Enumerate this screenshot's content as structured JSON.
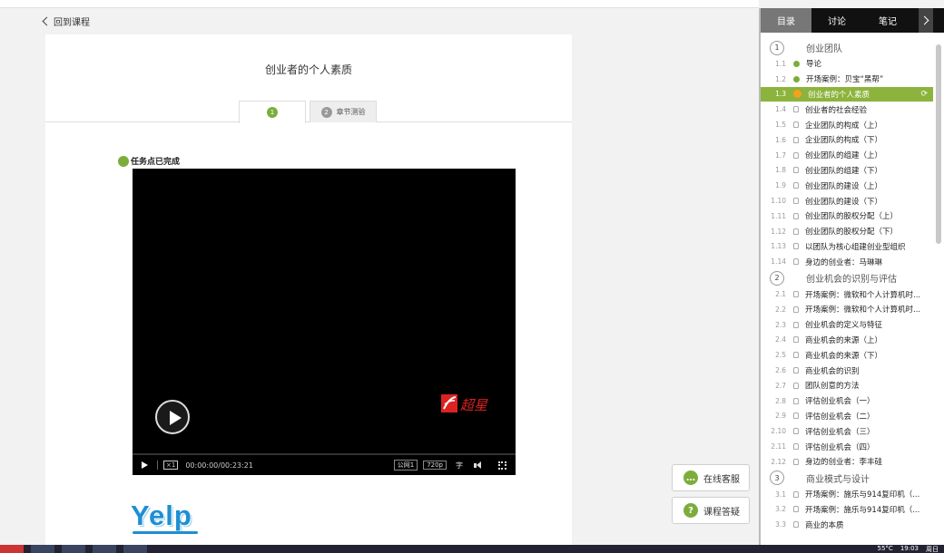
{
  "nav": {
    "back_label": "回到课程"
  },
  "lesson": {
    "title": "创业者的个人素质",
    "tabs": [
      {
        "num": "1",
        "label": ""
      },
      {
        "num": "2",
        "label": "章节测验"
      }
    ],
    "task_status": "任务点已完成"
  },
  "video": {
    "speed": "×1",
    "time": "00:00:00/00:23:21",
    "line_label": "公网1",
    "quality": "720p",
    "subtitle_icon": "字",
    "logo_text": "超星"
  },
  "content_image_text": "Yelp",
  "floating": {
    "chat_label": "在线客服",
    "faq_label": "课程答疑"
  },
  "panel": {
    "tabs": [
      "目录",
      "讨论",
      "笔记"
    ],
    "active_tab": "目录"
  },
  "toc": {
    "ch1": {
      "num": "1",
      "title": "创业团队",
      "items": [
        {
          "num": "1.1",
          "title": "导论",
          "state": "done"
        },
        {
          "num": "1.2",
          "title": "开场案例：贝宝“黑帮”",
          "state": "done"
        },
        {
          "num": "1.3",
          "title": "创业者的个人素质",
          "state": "current"
        },
        {
          "num": "1.4",
          "title": "创业者的社会经验",
          "state": "lock"
        },
        {
          "num": "1.5",
          "title": "企业团队的构成（上）",
          "state": "lock"
        },
        {
          "num": "1.6",
          "title": "企业团队的构成（下）",
          "state": "lock"
        },
        {
          "num": "1.7",
          "title": "创业团队的组建（上）",
          "state": "lock"
        },
        {
          "num": "1.8",
          "title": "创业团队的组建（下）",
          "state": "lock"
        },
        {
          "num": "1.9",
          "title": "创业团队的建设（上）",
          "state": "lock"
        },
        {
          "num": "1.10",
          "title": "创业团队的建设（下）",
          "state": "lock"
        },
        {
          "num": "1.11",
          "title": "创业团队的股权分配（上）",
          "state": "lock"
        },
        {
          "num": "1.12",
          "title": "创业团队的股权分配（下）",
          "state": "lock"
        },
        {
          "num": "1.13",
          "title": "以团队为核心组建创业型组织",
          "state": "lock"
        },
        {
          "num": "1.14",
          "title": "身边的创业者：马琳琳",
          "state": "lock"
        }
      ]
    },
    "ch2": {
      "num": "2",
      "title": "创业机会的识别与评估",
      "items": [
        {
          "num": "2.1",
          "title": "开场案例：微软和个人计算机时...",
          "state": "lock"
        },
        {
          "num": "2.2",
          "title": "开场案例：微软和个人计算机时...",
          "state": "lock"
        },
        {
          "num": "2.3",
          "title": "创业机会的定义与特征",
          "state": "lock"
        },
        {
          "num": "2.4",
          "title": "商业机会的来源（上）",
          "state": "lock"
        },
        {
          "num": "2.5",
          "title": "商业机会的来源（下）",
          "state": "lock"
        },
        {
          "num": "2.6",
          "title": "商业机会的识别",
          "state": "lock"
        },
        {
          "num": "2.7",
          "title": "团队创意的方法",
          "state": "lock"
        },
        {
          "num": "2.8",
          "title": "评估创业机会（一）",
          "state": "lock"
        },
        {
          "num": "2.9",
          "title": "评估创业机会（二）",
          "state": "lock"
        },
        {
          "num": "2.10",
          "title": "评估创业机会（三）",
          "state": "lock"
        },
        {
          "num": "2.11",
          "title": "评估创业机会（四）",
          "state": "lock"
        },
        {
          "num": "2.12",
          "title": "身边的创业者：李丰硅",
          "state": "lock"
        }
      ]
    },
    "ch3": {
      "num": "3",
      "title": "商业模式与设计",
      "items": [
        {
          "num": "3.1",
          "title": "开场案例：施乐与914复印机（...",
          "state": "lock"
        },
        {
          "num": "3.2",
          "title": "开场案例：施乐与914复印机（...",
          "state": "lock"
        },
        {
          "num": "3.3",
          "title": "商业的本质",
          "state": "lock"
        }
      ]
    }
  },
  "taskbar": {
    "temp": "55°C",
    "time": "19:03",
    "day": "周日"
  },
  "colors": {
    "accent": "#8cb33c",
    "current": "#f3a21d",
    "brand_blue": "#1e8fd3"
  }
}
